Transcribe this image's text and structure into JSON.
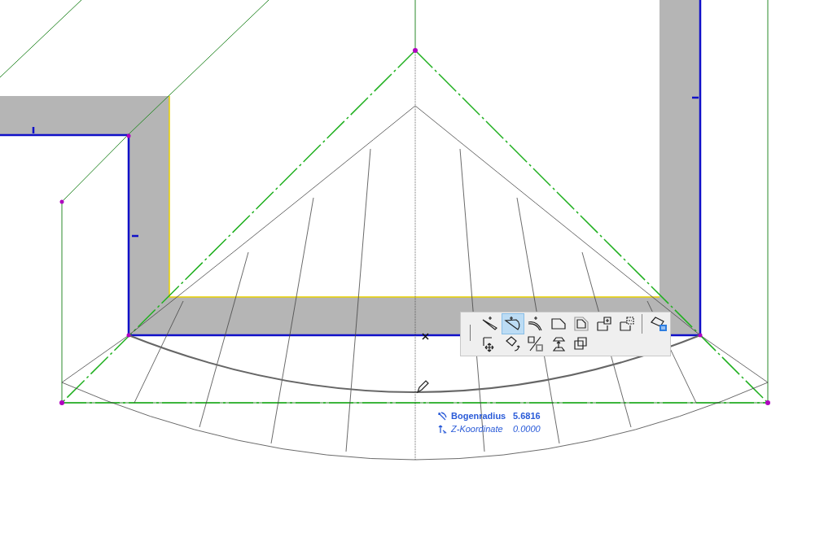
{
  "toolbar": {
    "rows": [
      [
        {
          "kind": "wedge",
          "selected": false
        },
        {
          "kind": "arc",
          "selected": true
        },
        {
          "kind": "curve",
          "selected": false
        },
        {
          "kind": "corner",
          "selected": false
        },
        {
          "kind": "chamfer",
          "selected": false
        },
        {
          "kind": "addcorner",
          "selected": false
        },
        {
          "kind": "subcorner",
          "selected": false
        },
        {
          "kind": "settings",
          "selected": false
        }
      ],
      [
        {
          "kind": "move",
          "selected": false
        },
        {
          "kind": "rotate",
          "selected": false
        },
        {
          "kind": "mirror",
          "selected": false
        },
        {
          "kind": "elevate",
          "selected": false
        },
        {
          "kind": "copy",
          "selected": false
        }
      ]
    ]
  },
  "tracker": [
    {
      "kind": "radius",
      "label": "Bogenradius",
      "value": "5.6816"
    },
    {
      "kind": "z",
      "label": "Z-Koordinate",
      "value": "0.0000"
    }
  ]
}
